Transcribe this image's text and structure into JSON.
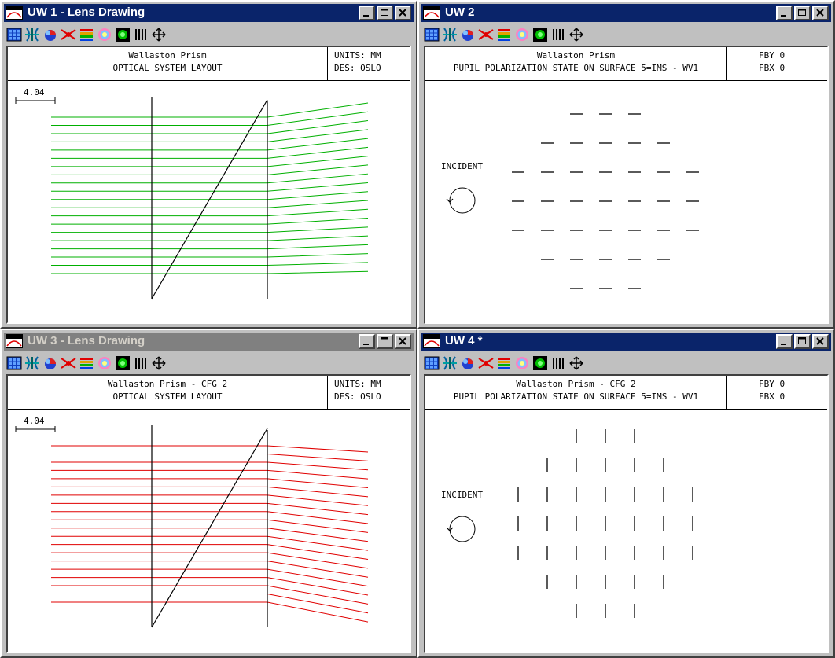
{
  "windows": [
    {
      "title": "UW 1 - Lens Drawing",
      "active": true,
      "header": {
        "line1": "Wallaston Prism",
        "line2": "OPTICAL SYSTEM LAYOUT",
        "right1": "UNITS: MM",
        "right2": "DES: OSLO"
      },
      "scale_label": "4.04",
      "ray_color": "#00b000"
    },
    {
      "title": "UW 2",
      "active": true,
      "header": {
        "line1": "Wallaston Prism",
        "line2": "PUPIL POLARIZATION STATE ON SURFACE 5=IMS - WV1",
        "right1": "FBY 0",
        "right2": "FBX 0"
      },
      "incident_label": "INCIDENT",
      "polarization_orientation": "horizontal"
    },
    {
      "title": "UW 3 - Lens Drawing",
      "active": false,
      "header": {
        "line1": "Wallaston Prism - CFG 2",
        "line2": "OPTICAL SYSTEM LAYOUT",
        "right1": "UNITS: MM",
        "right2": "DES: OSLO"
      },
      "scale_label": "4.04",
      "ray_color": "#e00000"
    },
    {
      "title": "UW 4 *",
      "active": true,
      "header": {
        "line1": "Wallaston Prism - CFG 2",
        "line2": "PUPIL POLARIZATION STATE ON SURFACE 5=IMS - WV1",
        "right1": "FBY 0",
        "right2": "FBX 0"
      },
      "incident_label": "INCIDENT",
      "polarization_orientation": "vertical"
    }
  ],
  "toolbar_icons": [
    "window-grid-icon",
    "lens-icon",
    "color-wheel-icon",
    "spot-icon",
    "rainbow-icon",
    "circle-icon",
    "target-icon",
    "bars-icon",
    "move-icon"
  ],
  "window_buttons": [
    "minimize-button",
    "maximize-button",
    "close-button"
  ]
}
